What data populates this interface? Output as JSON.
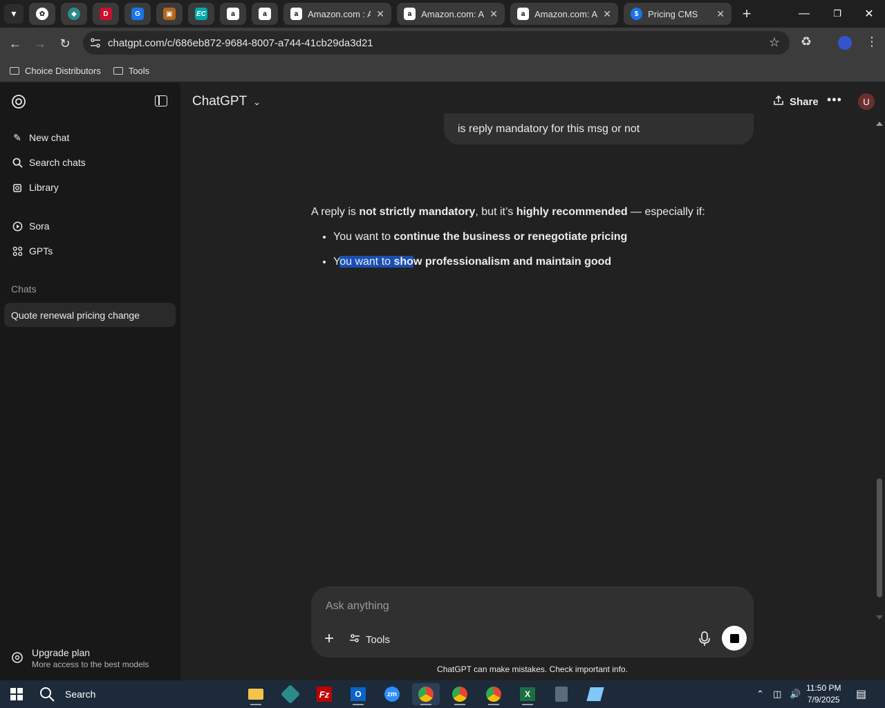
{
  "browser": {
    "tabs": [
      {
        "label": "Amazon.com : AL"
      },
      {
        "label": "Amazon.com: AL"
      },
      {
        "label": "Amazon.com: Alg"
      },
      {
        "label": "Pricing CMS"
      }
    ],
    "url": "chatgpt.com/c/686eb872-9684-8007-a744-41cb29da3d21",
    "bookmarks": [
      "Choice Distributors",
      "Tools"
    ]
  },
  "sidebar": {
    "new_chat": "New chat",
    "search_chats": "Search chats",
    "library": "Library",
    "sora": "Sora",
    "gpts": "GPTs",
    "section_chats": "Chats",
    "active_chat": "Quote renewal pricing change",
    "upgrade_title": "Upgrade plan",
    "upgrade_sub": "More access to the best models"
  },
  "header": {
    "model": "ChatGPT",
    "share": "Share",
    "avatar": "U"
  },
  "conversation": {
    "user_message": "is reply mandatory for this msg or not",
    "answer": {
      "p1": "A reply is ",
      "p1_b1": "not strictly mandatory",
      "p1_mid": ", but it’s ",
      "p1_b2": "highly recommended",
      "p1_end": " — especially if:",
      "b1_pre": "You want to ",
      "b1_bold": "continue the business or renegotiate pricing",
      "b2_first": "Y",
      "b2_sel1": "ou want to ",
      "b2_sel2": "sho",
      "b2_rest_bold": "w professionalism and maintain good"
    }
  },
  "composer": {
    "placeholder": "Ask anything",
    "tools": "Tools",
    "disclaimer": "ChatGPT can make mistakes. Check important info."
  },
  "taskbar": {
    "search": "Search",
    "time": "11:50 PM",
    "date": "7/9/2025"
  },
  "colors": {
    "background": "#212121",
    "sidebar": "#181818",
    "selection": "#1a4fb3"
  }
}
